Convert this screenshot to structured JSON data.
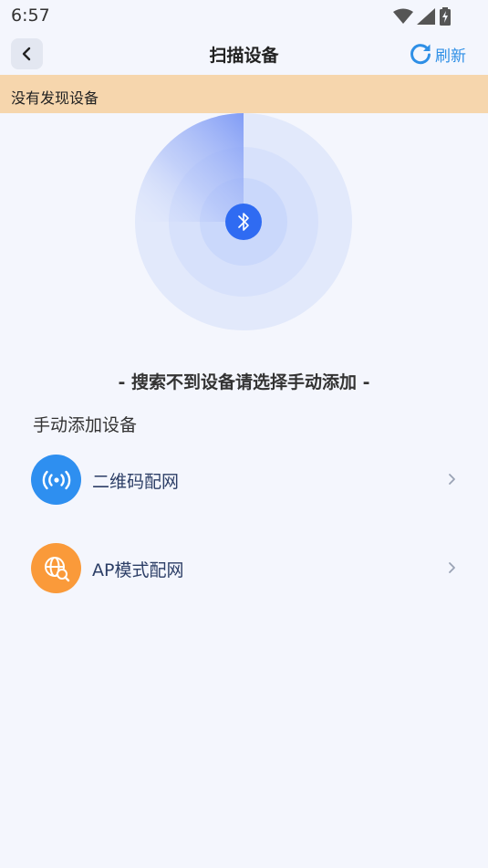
{
  "status_bar": {
    "time": "6:57",
    "icons": [
      "wifi-icon",
      "cellular-signal-icon",
      "battery-charging-icon"
    ]
  },
  "header": {
    "title": "扫描设备",
    "back_icon": "chevron-left-icon",
    "refresh_label": "刷新",
    "refresh_icon": "refresh-icon"
  },
  "banner": {
    "text": "没有发现设备",
    "color": "#F6D6AD"
  },
  "scan": {
    "icon": "bluetooth-icon",
    "hint": "- 搜索不到设备请选择手动添加 -"
  },
  "manual": {
    "section_title": "手动添加设备",
    "items": [
      {
        "label": "二维码配网",
        "icon": "broadcast-signal-icon",
        "color": "#2E8FF0"
      },
      {
        "label": "AP模式配网",
        "icon": "globe-search-icon",
        "color": "#FA9A3A"
      }
    ]
  },
  "colors": {
    "accent": "#2E8FE6",
    "background": "#F4F6FD"
  }
}
